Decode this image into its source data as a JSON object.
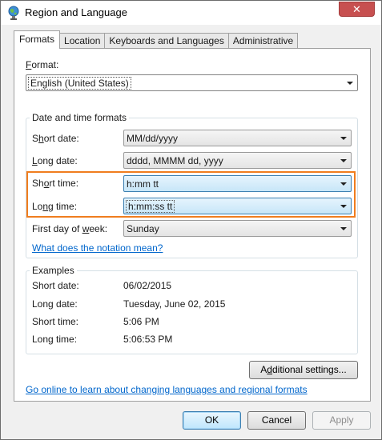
{
  "window": {
    "title": "Region and Language",
    "close_symbol": "✕"
  },
  "tabs": [
    {
      "label": "Formats",
      "active": true
    },
    {
      "label": "Location",
      "active": false
    },
    {
      "label": "Keyboards and Languages",
      "active": false
    },
    {
      "label": "Administrative",
      "active": false
    }
  ],
  "format": {
    "label_prefix": "",
    "label_ul": "F",
    "label_rest": "ormat:",
    "value": "English (United States)"
  },
  "datetime": {
    "group_title": "Date and time formats",
    "short_date": {
      "label_pre": "S",
      "label_ul": "h",
      "label_post": "ort date:",
      "value": "MM/dd/yyyy"
    },
    "long_date": {
      "label_pre": "",
      "label_ul": "L",
      "label_post": "ong date:",
      "value": "dddd, MMMM dd, yyyy"
    },
    "short_time": {
      "label_pre": "Sh",
      "label_ul": "o",
      "label_post": "rt time:",
      "value": "h:mm tt"
    },
    "long_time": {
      "label_pre": "Lo",
      "label_ul": "n",
      "label_post": "g time:",
      "value": "h:mm:ss tt"
    },
    "first_day": {
      "label_pre": "First day of ",
      "label_ul": "w",
      "label_post": "eek:",
      "value": "Sunday"
    },
    "notation_link": "What does the notation mean?"
  },
  "examples": {
    "group_title": "Examples",
    "rows": [
      {
        "label": "Short date:",
        "value": "06/02/2015"
      },
      {
        "label": "Long date:",
        "value": "Tuesday, June 02, 2015"
      },
      {
        "label": "Short time:",
        "value": "5:06 PM"
      },
      {
        "label": "Long time:",
        "value": "5:06:53 PM"
      }
    ]
  },
  "additional_settings_pre": "A",
  "additional_settings_ul": "d",
  "additional_settings_post": "ditional settings...",
  "online_link": "Go online to learn about changing languages and regional formats",
  "buttons": {
    "ok": "OK",
    "cancel": "Cancel",
    "apply": "Apply"
  },
  "colors": {
    "highlight_border": "#f07d1e",
    "link": "#0066cc",
    "close": "#c75050"
  }
}
